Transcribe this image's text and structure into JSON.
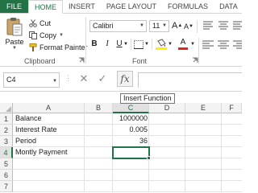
{
  "ribbon": {
    "tabs": [
      "FILE",
      "HOME",
      "INSERT",
      "PAGE LAYOUT",
      "FORMULAS",
      "DATA"
    ],
    "active_tab": "HOME",
    "clipboard": {
      "paste_label": "Paste",
      "cut_label": "Cut",
      "copy_label": "Copy",
      "format_painter_label": "Format Painter",
      "group_label": "Clipboard"
    },
    "font": {
      "font_name": "Calibri",
      "font_size": "11",
      "bold": "B",
      "italic": "I",
      "underline": "U",
      "grow_font": "A",
      "shrink_font": "A",
      "font_color_label": "A",
      "group_label": "Font"
    }
  },
  "formula_bar": {
    "name_box": "C4",
    "fx_label": "fx",
    "formula": "",
    "tooltip": "Insert Function"
  },
  "grid": {
    "columns": [
      "A",
      "B",
      "C",
      "D",
      "E",
      "F"
    ],
    "selected_column": "C",
    "rows": [
      "1",
      "2",
      "3",
      "4",
      "5",
      "6",
      "7"
    ],
    "selected_row": "4",
    "cells": {
      "A1": "Balance",
      "C1": "1000000",
      "A2": "Interest Rate",
      "C2": "0.005",
      "A3": "Period",
      "C3": "36",
      "A4": "Montly Payment"
    }
  },
  "colors": {
    "excel_green": "#217346",
    "font_color_bar": "#e3241a",
    "fill_color_bar": "#ffee00"
  }
}
